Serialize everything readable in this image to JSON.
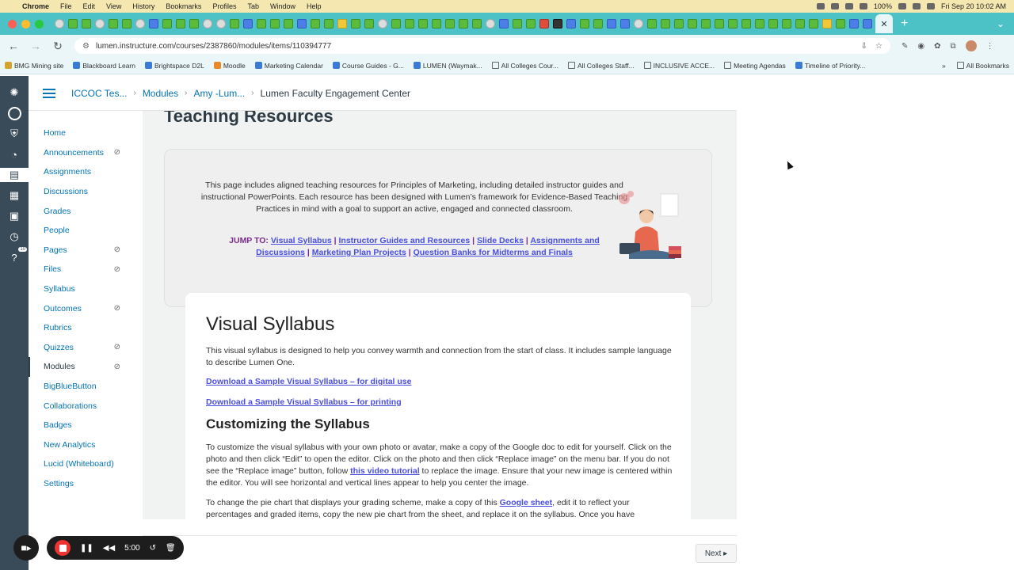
{
  "macbar": {
    "app": "Chrome",
    "menus": [
      "File",
      "Edit",
      "View",
      "History",
      "Bookmarks",
      "Profiles",
      "Tab",
      "Window",
      "Help"
    ],
    "battery": "100%",
    "clock": "Fri Sep 20 10:02 AM"
  },
  "browser": {
    "url": "lumen.instructure.com/courses/2387860/modules/items/110394777",
    "new_tab": "+",
    "bookmarks": [
      {
        "label": "BMG Mining site",
        "icon": "gold"
      },
      {
        "label": "Blackboard Learn",
        "icon": "blue"
      },
      {
        "label": "Brightspace D2L",
        "icon": "blue"
      },
      {
        "label": "Moodle",
        "icon": "orange"
      },
      {
        "label": "Marketing Calendar",
        "icon": "blue"
      },
      {
        "label": "Course Guides - G...",
        "icon": "blue"
      },
      {
        "label": "LUMEN (Waymak...",
        "icon": "blue"
      },
      {
        "label": "All Colleges Cour...",
        "icon": "folder"
      },
      {
        "label": "All Colleges Staff...",
        "icon": "folder"
      },
      {
        "label": "INCLUSIVE ACCE...",
        "icon": "folder"
      },
      {
        "label": "Meeting Agendas",
        "icon": "folder"
      },
      {
        "label": "Timeline of Priority...",
        "icon": "blue"
      }
    ],
    "all_bookmarks": "All Bookmarks"
  },
  "breadcrumb": {
    "course": "ICCOC Tes...",
    "modules": "Modules",
    "module": "Amy -Lum...",
    "current": "Lumen Faculty Engagement Center"
  },
  "global_nav_badge": "10",
  "course_nav": [
    {
      "label": "Home",
      "hidden": false
    },
    {
      "label": "Announcements",
      "hidden": true
    },
    {
      "label": "Assignments",
      "hidden": false
    },
    {
      "label": "Discussions",
      "hidden": false
    },
    {
      "label": "Grades",
      "hidden": false
    },
    {
      "label": "People",
      "hidden": false
    },
    {
      "label": "Pages",
      "hidden": true
    },
    {
      "label": "Files",
      "hidden": true
    },
    {
      "label": "Syllabus",
      "hidden": false
    },
    {
      "label": "Outcomes",
      "hidden": true
    },
    {
      "label": "Rubrics",
      "hidden": false
    },
    {
      "label": "Quizzes",
      "hidden": true
    },
    {
      "label": "Modules",
      "hidden": true,
      "active": true
    },
    {
      "label": "BigBlueButton",
      "hidden": false
    },
    {
      "label": "Collaborations",
      "hidden": false
    },
    {
      "label": "Badges",
      "hidden": false
    },
    {
      "label": "New Analytics",
      "hidden": false
    },
    {
      "label": "Lucid (Whiteboard)",
      "hidden": false
    },
    {
      "label": "Settings",
      "hidden": false
    }
  ],
  "content": {
    "title": "Teaching Resources",
    "intro": "This page includes aligned teaching resources for Principles of Marketing, including detailed instructor guides and instructional PowerPoints. Each resource has been designed with Lumen’s framework for Evidence-Based Teaching Practices in mind with a goal to support an active, engaged and connected classroom.",
    "jump_label": "JUMP TO:",
    "jump_links": [
      "Visual Syllabus",
      "Instructor Guides and Resources",
      "Slide Decks",
      "Assignments and Discussions",
      "Marketing Plan Projects",
      "Question Banks for Midterms and Finals"
    ],
    "section_title": "Visual Syllabus",
    "section_intro": "This visual syllabus is designed to help you convey warmth and connection from the start of class. It includes sample language to describe Lumen One.",
    "download_digital": "Download a Sample Visual Syllabus – for digital use",
    "download_print": "Download a Sample Visual Syllabus – for printing",
    "subsection_title": "Customizing the Syllabus",
    "custom_p1_a": "To customize the visual syllabus with your own photo or avatar, make a copy of the Google doc to edit for yourself. Click on the photo and then click “Edit” to open the editor. Click on the photo and then click “Replace image” on the menu bar. If you do not see the “Replace image” button, follow ",
    "custom_p1_link": "this video tutorial",
    "custom_p1_b": " to replace the image. Ensure that your new image is centered within the editor. You will see horizontal and vertical lines appear to help you center the image.",
    "custom_p2_a": "To change the pie chart that displays your grading scheme, make a copy of this ",
    "custom_p2_link": "Google sheet",
    "custom_p2_b": ", edit it to reflect your percentages and graded items, copy the new pie chart from the sheet, and replace it on the syllabus. Once you have"
  },
  "footer": {
    "next": "Next ▸"
  },
  "recorder": {
    "time": "5:00"
  }
}
